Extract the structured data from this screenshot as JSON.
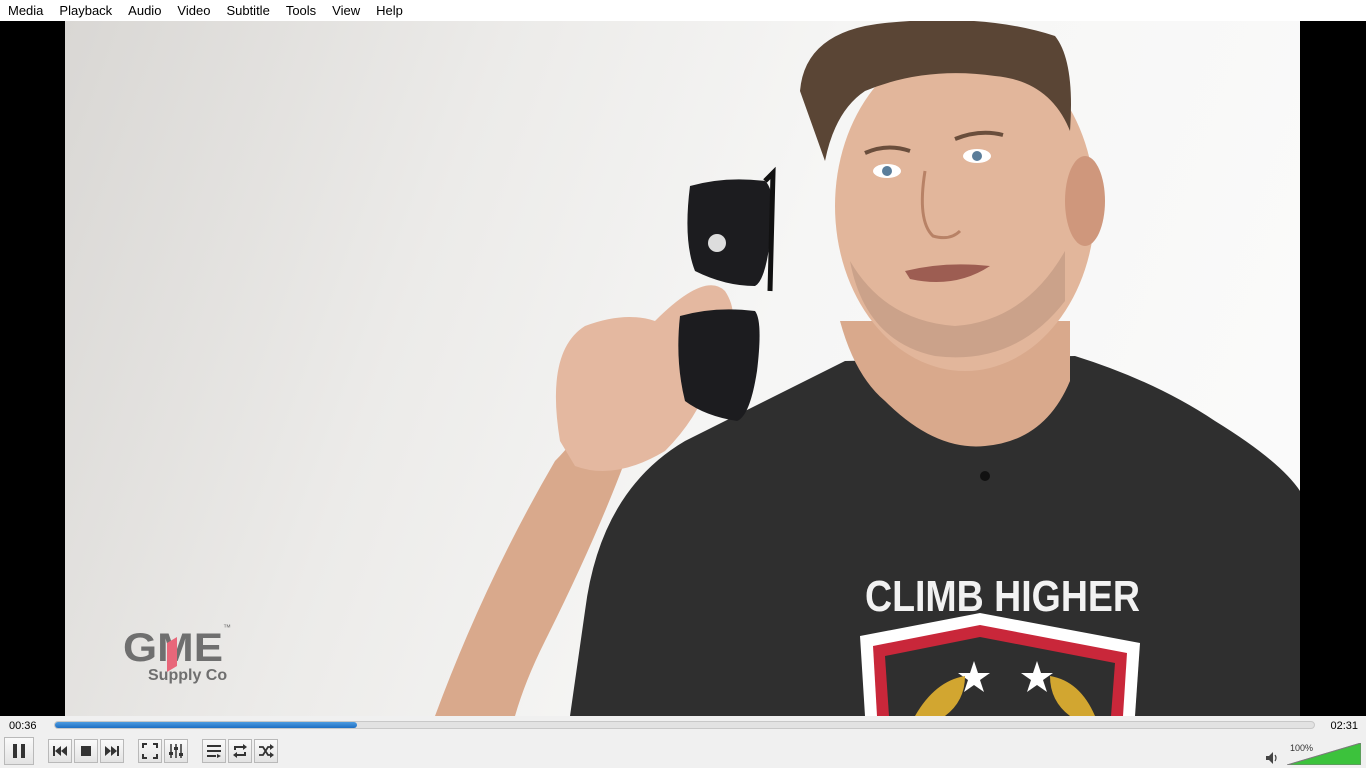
{
  "menu": [
    {
      "label": "Media"
    },
    {
      "label": "Playback"
    },
    {
      "label": "Audio"
    },
    {
      "label": "Video"
    },
    {
      "label": "Subtitle"
    },
    {
      "label": "Tools"
    },
    {
      "label": "View"
    },
    {
      "label": "Help"
    }
  ],
  "video": {
    "logo_letters": "GME",
    "logo_trademark": "™",
    "logo_subtitle": "Supply Co",
    "shirt_text": "CLIMB HIGHER"
  },
  "playback": {
    "elapsed": "00:36",
    "total": "02:31",
    "progress_fraction": 0.24
  },
  "controls": {
    "buttons": [
      "pause-icon",
      "previous-icon",
      "stop-icon",
      "next-icon",
      "fullscreen-icon",
      "extended-settings-icon",
      "playlist-icon",
      "loop-icon",
      "shuffle-icon"
    ]
  },
  "volume": {
    "label": "100%",
    "level_fraction": 1.0
  },
  "colors": {
    "seek_fill": "#1e6fc3",
    "volume_fill": "#3cc23c"
  }
}
